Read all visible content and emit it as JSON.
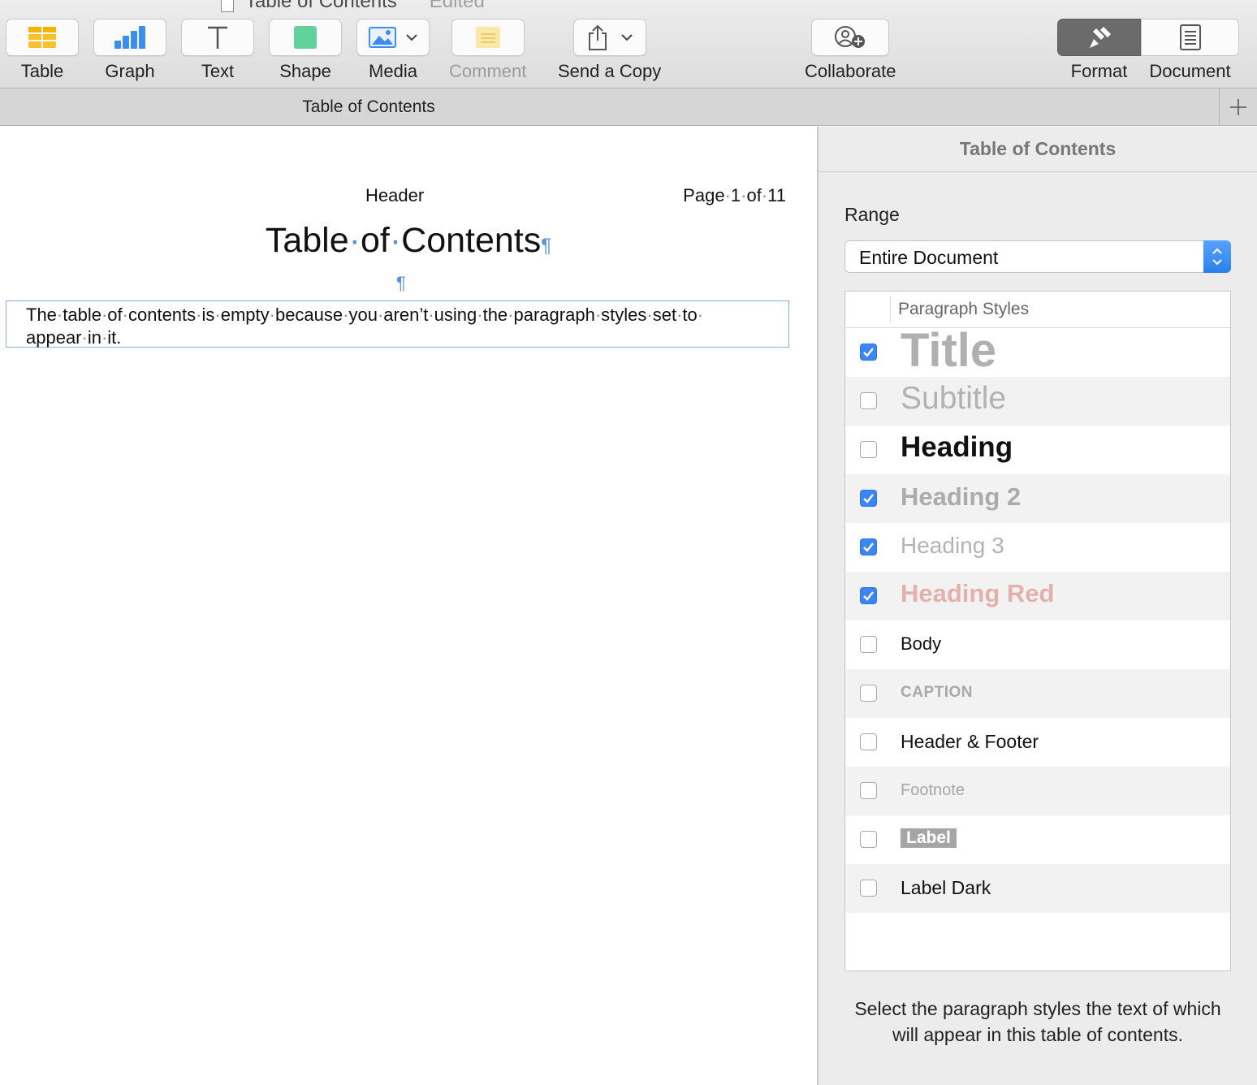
{
  "window": {
    "title": "Table of Contents",
    "status": "Edited"
  },
  "toolbar": {
    "items": [
      {
        "label": "Table",
        "icon": "table-icon"
      },
      {
        "label": "Graph",
        "icon": "chart-icon"
      },
      {
        "label": "Text",
        "icon": "text-icon"
      },
      {
        "label": "Shape",
        "icon": "shape-icon"
      },
      {
        "label": "Media",
        "icon": "media-icon"
      },
      {
        "label": "Comment",
        "icon": "comment-icon"
      },
      {
        "label": "Send a Copy",
        "icon": "share-icon"
      },
      {
        "label": "Collaborate",
        "icon": "collaborate-icon"
      }
    ],
    "format_label": "Format",
    "document_label": "Document"
  },
  "tabs": {
    "active": "Table of Contents"
  },
  "document": {
    "header_center": "Header",
    "header_right": "Page·1·of·11",
    "title": "Table·of·Contents",
    "pilcrow": "¶",
    "toc_message": "The·table·of·contents·is·empty·because·you·aren’t·using·the·paragraph·styles·set·to· appear·in·it."
  },
  "inspector": {
    "title": "Table of Contents",
    "range_label": "Range",
    "range_value": "Entire Document",
    "list_header": "Paragraph Styles",
    "styles": [
      {
        "name": "Title",
        "checked": true
      },
      {
        "name": "Subtitle",
        "checked": false
      },
      {
        "name": "Heading",
        "checked": false
      },
      {
        "name": "Heading 2",
        "checked": true
      },
      {
        "name": "Heading 3",
        "checked": true
      },
      {
        "name": "Heading Red",
        "checked": true
      },
      {
        "name": "Body",
        "checked": false
      },
      {
        "name": "CAPTION",
        "checked": false
      },
      {
        "name": "Header & Footer",
        "checked": false
      },
      {
        "name": "Footnote",
        "checked": false
      },
      {
        "name": "Label",
        "checked": false
      },
      {
        "name": "Label Dark",
        "checked": false
      }
    ],
    "note": "Select the paragraph styles the text of which will appear in this table of contents."
  },
  "colors": {
    "accent": "#3a86f5",
    "heading_red": "#e2b1ac",
    "format_active": "#6b6b6b"
  }
}
